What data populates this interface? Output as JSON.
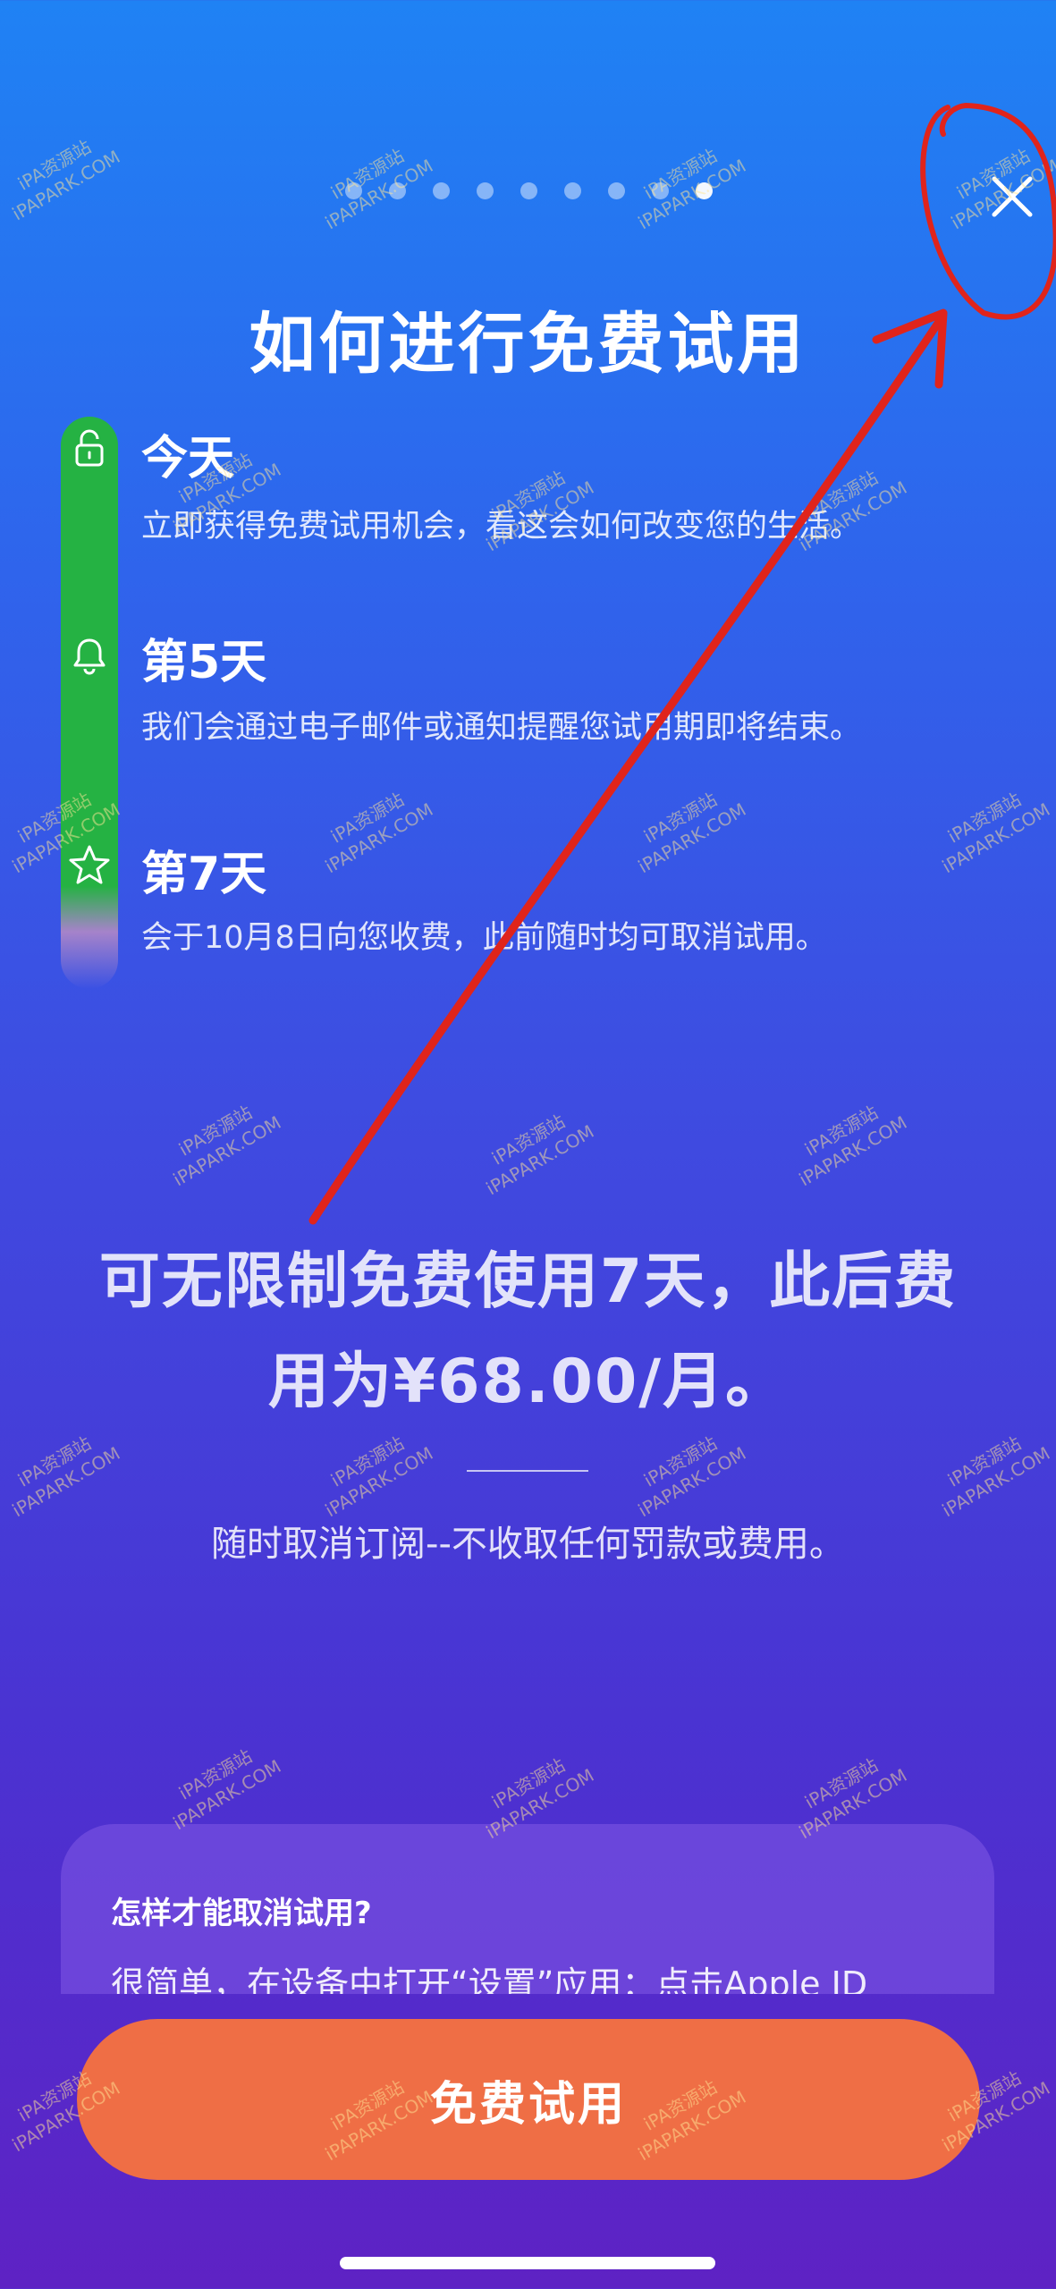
{
  "pagination": {
    "total": 9,
    "active_index": 8
  },
  "title": "如何进行免费试用",
  "timeline": [
    {
      "title": "今天",
      "desc": "立即获得免费试用机会，看这会如何改变您的生活。",
      "icon": "unlock-icon"
    },
    {
      "title": "第5天",
      "desc": "我们会通过电子邮件或通知提醒您试用期即将结束。",
      "icon": "bell-icon"
    },
    {
      "title": "第7天",
      "desc": "会于10月8日向您收费，此前随时均可取消试用。",
      "icon": "star-icon"
    }
  ],
  "offer": {
    "line1": "可无限制免费使用7天，此后费",
    "line2": "用为¥68.00/月。"
  },
  "cancel_note": "随时取消订阅--不收取任何罚款或费用。",
  "faq": {
    "question": "怎样才能取消试用?",
    "answer": "很简单，在设备中打开“设置”应用：点击Apple ID"
  },
  "cta_label": "免费试用",
  "watermark": {
    "line1": "iPA资源站",
    "line2": "iPAPARK.COM"
  },
  "colors": {
    "bg_top": "#1f82f4",
    "bg_bottom": "#5e22c4",
    "timeline_green": "#25b243",
    "cta_orange": "#ef6e45",
    "annotation_red": "#e0241b"
  }
}
